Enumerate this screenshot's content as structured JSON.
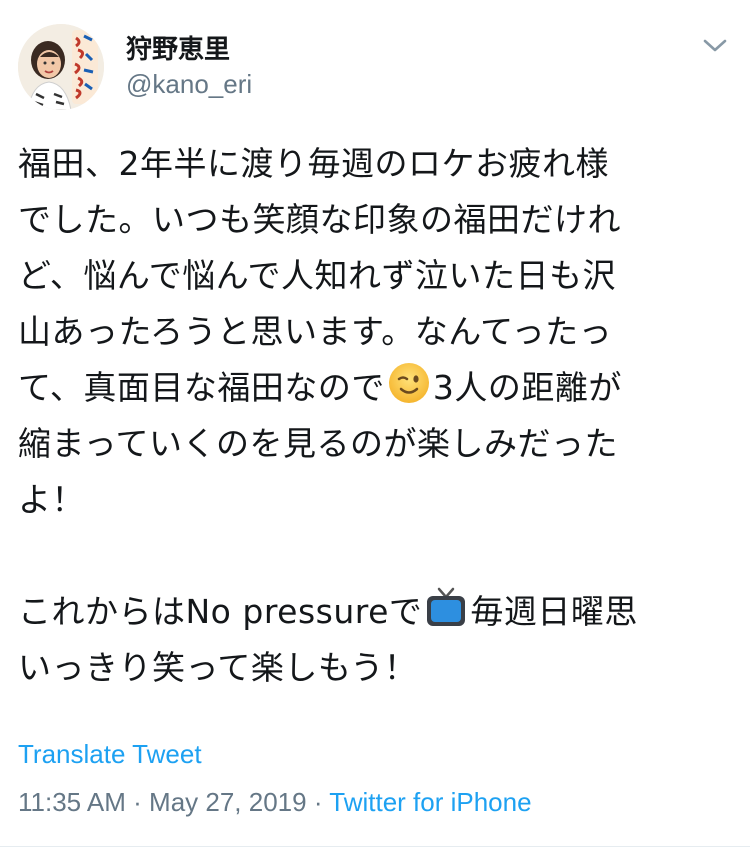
{
  "author": {
    "display_name": "狩野恵里",
    "handle": "@kano_eri",
    "avatar_icon": "profile-photo-icon",
    "menu_icon": "chevron-down-icon"
  },
  "tweet": {
    "lines": [
      "福田、2年半に渡り毎週のロケお疲れ様",
      "でした。いつも笑顔な印象の福田だけれ",
      "ど、悩んで悩んで人知れず泣いた日も沢",
      "山あったろうと思います。なんてったっ",
      "て、真面目な福田なので",
      "3人の距離が",
      "縮まっていくのを見るのが楽しみだった",
      "よ！",
      "これからはNo pressureで",
      "毎週日曜思",
      "いっきり笑って楽しもう！"
    ],
    "emoji_wink": "winking-face-emoji",
    "emoji_tv": "television-emoji"
  },
  "translate_label": "Translate Tweet",
  "meta": {
    "time": "11:35 AM",
    "separator": " · ",
    "date": "May 27, 2019",
    "source": "Twitter for iPhone"
  },
  "colors": {
    "link": "#1da1f2",
    "secondary": "#657786",
    "text": "#14171a"
  }
}
